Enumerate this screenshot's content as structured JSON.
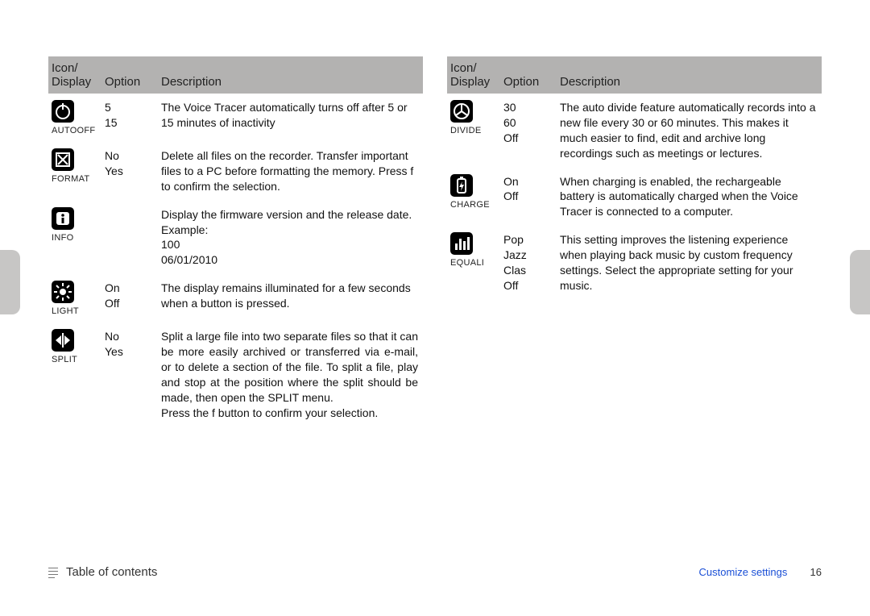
{
  "headers": {
    "icon": "Icon/\nDisplay",
    "option": "Option",
    "description": "Description"
  },
  "left": [
    {
      "icon_name": "autooff-icon",
      "label": "AUTOOFF",
      "options": "5\n15",
      "description": "The Voice Tracer automatically turns off after 5 or 15 minutes of inactivity",
      "justify": false
    },
    {
      "icon_name": "format-icon",
      "label": "FORMAT",
      "options": "No\nYes",
      "description": "Delete all files on the recorder. Transfer important files to a PC before formatting the memory. Press f      to confirm the selection.",
      "justify": false
    },
    {
      "icon_name": "info-icon",
      "label": "INFO",
      "options": "",
      "description": "Display the firmware version and the release date.\nExample:\n100\n06/01/2010",
      "justify": false
    },
    {
      "icon_name": "light-icon",
      "label": "LIGHT",
      "options": "On\nOff",
      "description": "The display remains illuminated for a few seconds when a button is pressed.",
      "justify": false
    },
    {
      "icon_name": "split-icon",
      "label": "SPLIT",
      "options": "No\nYes",
      "description": "Split a large file into two separate files so that it can be more easily archived or transferred via e-mail, or to delete a section of the file. To split a file, play and stop at the position where the split should be made, then open the SPLIT menu.\nPress the f      button to confirm your selection.",
      "justify": true
    }
  ],
  "right": [
    {
      "icon_name": "divide-icon",
      "label": "DIVIDE",
      "options": "30\n60\nOff",
      "description": "The auto divide feature automatically records into a new file every 30 or 60 minutes. This makes it much easier to find, edit and archive long recordings such as meetings or lectures.",
      "justify": false
    },
    {
      "icon_name": "charge-icon",
      "label": "CHARGE",
      "options": "On\nOff",
      "description": "When charging is enabled, the rechargeable battery is automatically charged when the Voice Tracer is connected to a computer.",
      "justify": false
    },
    {
      "icon_name": "equali-icon",
      "label": "EQUALI",
      "options": "Pop\nJazz\nClas\nOff",
      "description": "This setting improves the listening experience when playing back music by custom frequency settings. Select the appropriate setting for your music.",
      "justify": false
    }
  ],
  "footer": {
    "toc": "Table of contents",
    "section": "Customize settings",
    "page": "16"
  }
}
